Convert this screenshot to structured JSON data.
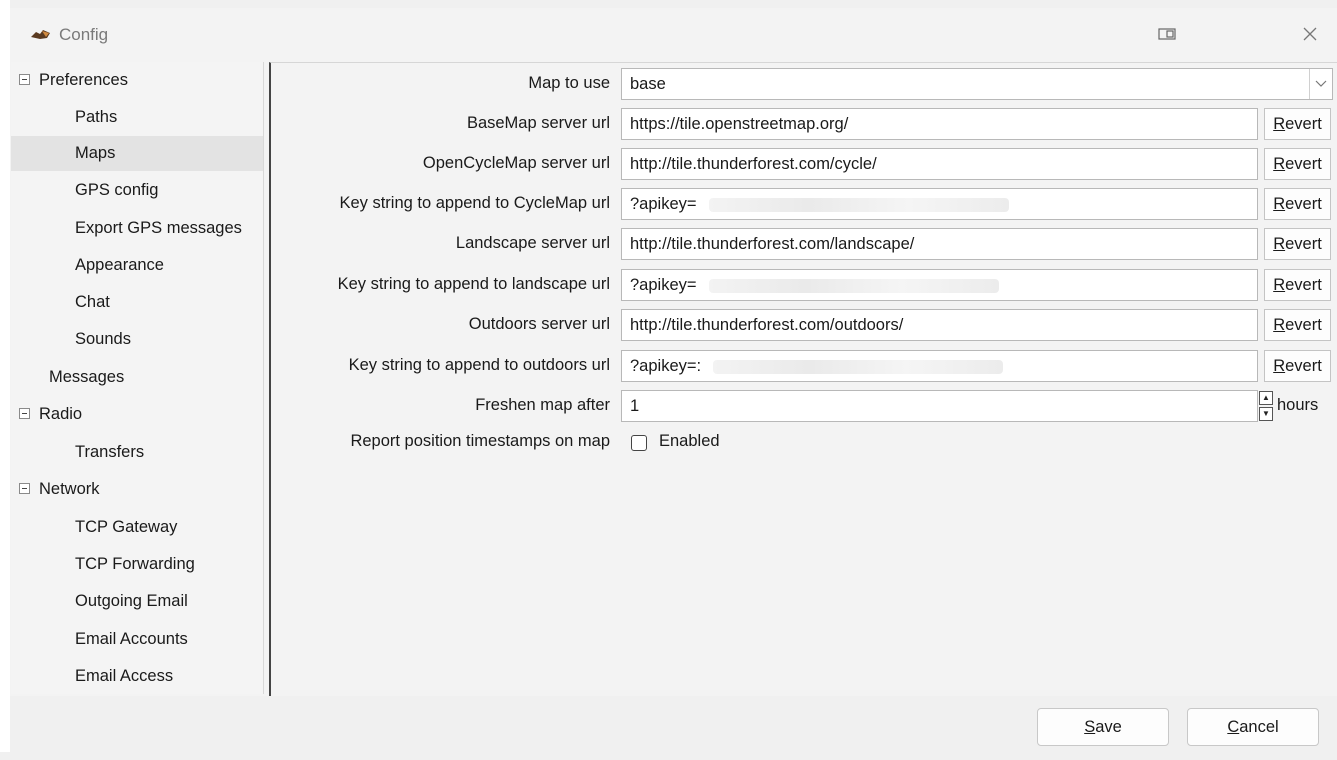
{
  "window": {
    "title": "Config"
  },
  "tree": {
    "items": [
      {
        "label": "Preferences",
        "level": 0,
        "expander": true
      },
      {
        "label": "Paths",
        "level": 1
      },
      {
        "label": "Maps",
        "level": 1,
        "selected": true
      },
      {
        "label": "GPS config",
        "level": 1
      },
      {
        "label": "Export GPS messages",
        "level": 1
      },
      {
        "label": "Appearance",
        "level": 1
      },
      {
        "label": "Chat",
        "level": 1
      },
      {
        "label": "Sounds",
        "level": 1
      },
      {
        "label": "Messages",
        "level": 0,
        "expander": false
      },
      {
        "label": "Radio",
        "level": 0,
        "expander": true
      },
      {
        "label": "Transfers",
        "level": 1
      },
      {
        "label": "Network",
        "level": 0,
        "expander": true
      },
      {
        "label": "TCP Gateway",
        "level": 1
      },
      {
        "label": "TCP Forwarding",
        "level": 1
      },
      {
        "label": "Outgoing Email",
        "level": 1
      },
      {
        "label": "Email Accounts",
        "level": 1
      },
      {
        "label": "Email Access",
        "level": 1
      }
    ]
  },
  "settings": {
    "map_to_use": {
      "label": "Map to use",
      "value": "base"
    },
    "basemap_url": {
      "label": "BaseMap server url",
      "value": "https://tile.openstreetmap.org/"
    },
    "opencyclemap_url": {
      "label": "OpenCycleMap server url",
      "value": "http://tile.thunderforest.com/cycle/"
    },
    "cyclemap_key": {
      "label": "Key string to append to CycleMap url",
      "value": "?apikey="
    },
    "landscape_url": {
      "label": "Landscape server url",
      "value": "http://tile.thunderforest.com/landscape/"
    },
    "landscape_key": {
      "label": "Key string to append to landscape url",
      "value": "?apikey="
    },
    "outdoors_url": {
      "label": "Outdoors server url",
      "value": "http://tile.thunderforest.com/outdoors/"
    },
    "outdoors_key": {
      "label": "Key string to append to outdoors url",
      "value": "?apikey=:"
    },
    "freshen": {
      "label": "Freshen map after",
      "value": "1",
      "unit": "hours"
    },
    "report_timestamps": {
      "label": "Report position timestamps on map",
      "checkbox_label": "Enabled",
      "checked": false
    },
    "revert_prefix": "R",
    "revert_rest": "evert"
  },
  "footer": {
    "save_prefix": "S",
    "save_rest": "ave",
    "cancel_prefix": "C",
    "cancel_rest": "ancel"
  }
}
